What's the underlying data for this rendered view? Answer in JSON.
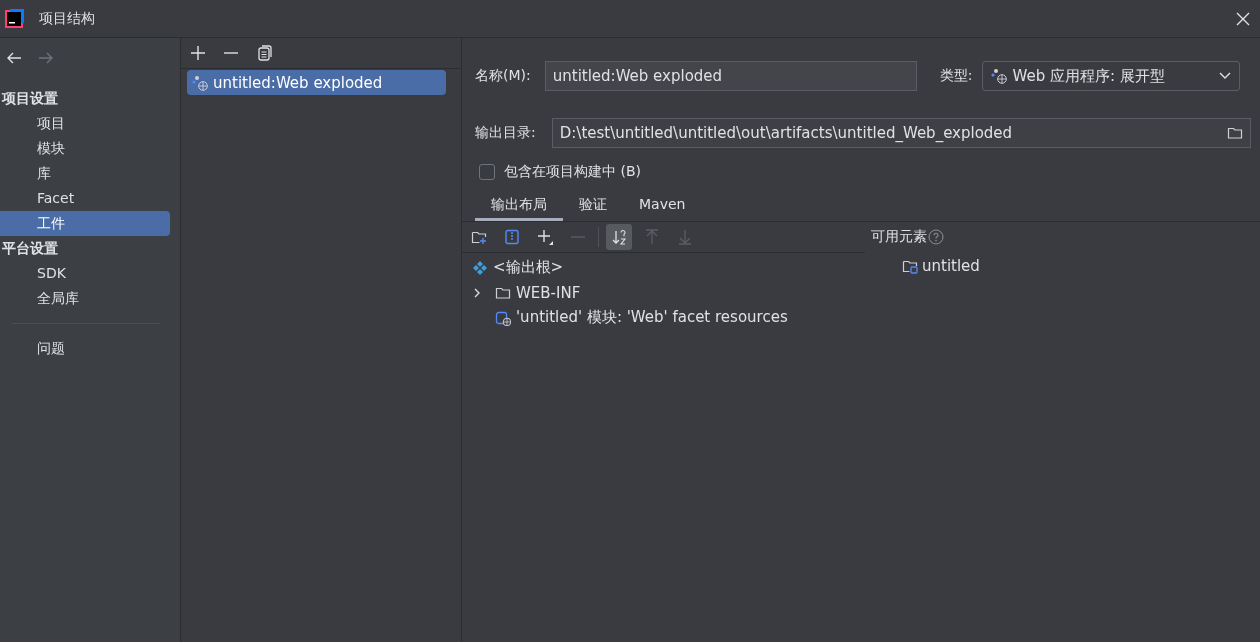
{
  "window": {
    "title": "项目结构"
  },
  "sidebar": {
    "sections": [
      {
        "heading": "项目设置",
        "items": [
          {
            "label": "项目",
            "selected": false
          },
          {
            "label": "模块",
            "selected": false
          },
          {
            "label": "库",
            "selected": false
          },
          {
            "label": "Facet",
            "selected": false
          },
          {
            "label": "工件",
            "selected": true
          }
        ]
      },
      {
        "heading": "平台设置",
        "items": [
          {
            "label": "SDK",
            "selected": false
          },
          {
            "label": "全局库",
            "selected": false
          }
        ]
      }
    ],
    "extra_items": [
      {
        "label": "问题",
        "selected": false
      }
    ]
  },
  "artifacts": [
    {
      "label": "untitled:Web exploded",
      "selected": true
    }
  ],
  "form": {
    "name_label": "名称(M):",
    "name_value": "untitled:Web exploded",
    "type_label": "类型:",
    "type_value": "Web 应用程序: 展开型",
    "output_label": "输出目录:",
    "output_value": "D:\\test\\untitled\\untitled\\out\\artifacts\\untitled_Web_exploded",
    "include": {
      "label": "包含在项目构建中 (B)",
      "checked": false
    }
  },
  "tabs": [
    {
      "label": "输出布局",
      "selected": true
    },
    {
      "label": "验证",
      "selected": false
    },
    {
      "label": "Maven",
      "selected": false
    }
  ],
  "layout_tree": [
    {
      "label": "<输出根>",
      "kind": "root"
    },
    {
      "label": "WEB-INF",
      "kind": "folder",
      "expanded": false
    },
    {
      "label": "'untitled' 模块: 'Web' facet resources",
      "kind": "facet"
    }
  ],
  "available": {
    "label": "可用元素",
    "items": [
      {
        "label": "untitled",
        "kind": "module"
      }
    ]
  }
}
